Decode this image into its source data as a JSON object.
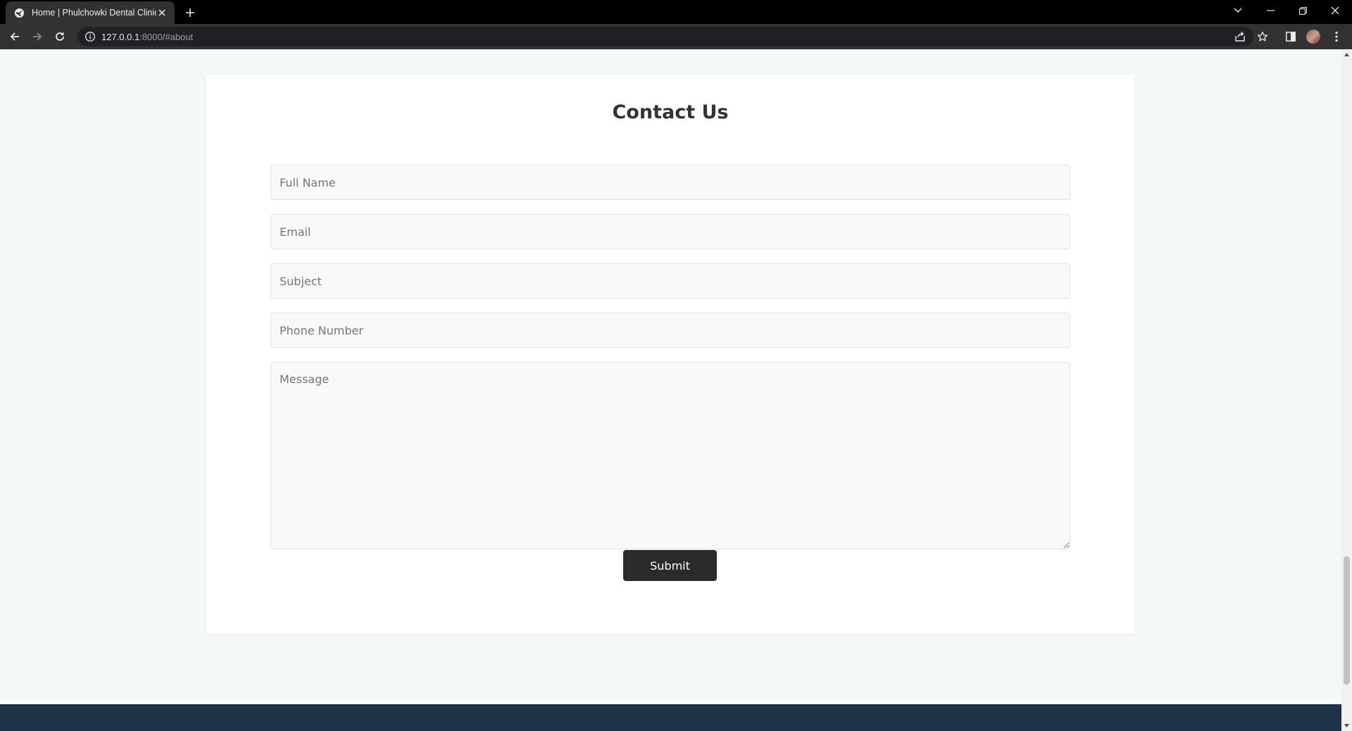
{
  "browser": {
    "tab": {
      "title": "Home | Phulchowki Dental Clinic"
    },
    "address": {
      "host": "127.0.0.1",
      "rest": ":8000/#about"
    }
  },
  "contact": {
    "heading": "Contact Us",
    "fields": {
      "full_name": {
        "placeholder": "Full Name",
        "value": ""
      },
      "email": {
        "placeholder": "Email",
        "value": ""
      },
      "subject": {
        "placeholder": "Subject",
        "value": ""
      },
      "phone": {
        "placeholder": "Phone Number",
        "value": ""
      },
      "message": {
        "placeholder": "Message",
        "value": ""
      }
    },
    "submit_label": "Submit"
  },
  "colors": {
    "page_background": "#f4f8f8",
    "card_background": "#ffffff",
    "button_background": "#2b2b2b",
    "footer_background": "#1e3248"
  },
  "icons": {
    "tab_favicon": "globe-icon",
    "tab_close": "close-icon",
    "new_tab": "plus-icon",
    "back": "arrow-left-icon",
    "forward": "arrow-right-icon",
    "reload": "reload-icon",
    "site_info": "info-icon",
    "share": "share-icon",
    "bookmark": "star-icon",
    "side_panel": "side-panel-icon",
    "menu": "kebab-menu-icon"
  }
}
